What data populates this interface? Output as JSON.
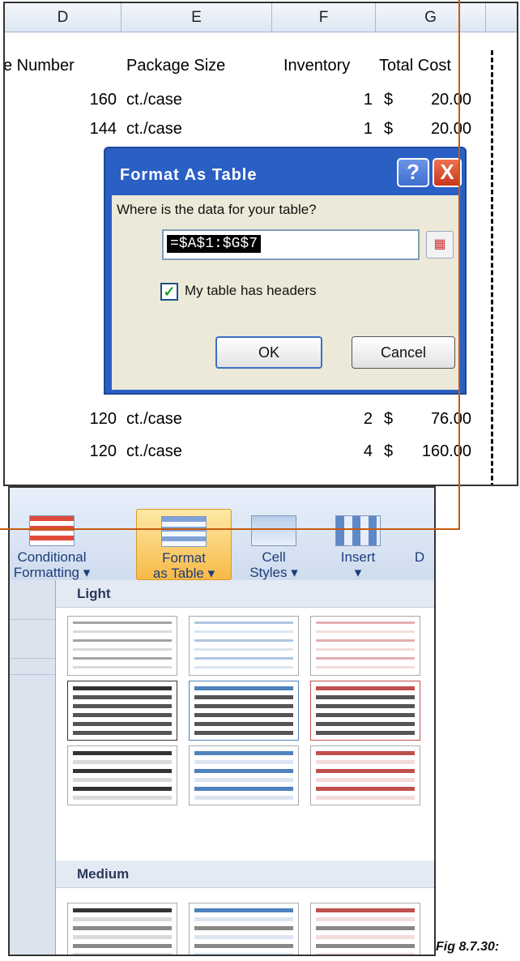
{
  "spreadsheet": {
    "column_headers": [
      "D",
      "E",
      "F",
      "G"
    ],
    "field_headers": [
      "e Number",
      "Package Size",
      "Inventory",
      "Total Cost"
    ],
    "rows": [
      {
        "number": "160",
        "size": "ct./case",
        "inventory": "1",
        "currency": "$",
        "cost": "20.00"
      },
      {
        "number": "144",
        "size": "ct./case",
        "inventory": "1",
        "currency": "$",
        "cost": "20.00"
      },
      {
        "number": "120",
        "size": "ct./case",
        "inventory": "2",
        "currency": "$",
        "cost": "76.00"
      },
      {
        "number": "120",
        "size": "ct./case",
        "inventory": "4",
        "currency": "$",
        "cost": "160.00"
      }
    ]
  },
  "dialog": {
    "title": "Format As Table",
    "help_label": "?",
    "close_label": "X",
    "prompt": "Where is the data for your table?",
    "range_value": "=$A$1:$G$7",
    "has_headers_checked": true,
    "has_headers_label": "My table has headers",
    "ok_label": "OK",
    "cancel_label": "Cancel"
  },
  "ribbon": {
    "buttons": [
      {
        "line1": "Conditional",
        "line2": "Formatting ▾"
      },
      {
        "line1": "Format",
        "line2": "as Table ▾"
      },
      {
        "line1": "Cell",
        "line2": "Styles ▾"
      },
      {
        "line1": "Insert",
        "line2": "▾"
      },
      {
        "line1": "D",
        "line2": ""
      }
    ]
  },
  "gallery": {
    "sections": [
      "Light",
      "Medium"
    ],
    "accent_colors": [
      "#333333",
      "#4f81bd",
      "#c0504d"
    ]
  },
  "caption": "Fig 8.7.30:"
}
